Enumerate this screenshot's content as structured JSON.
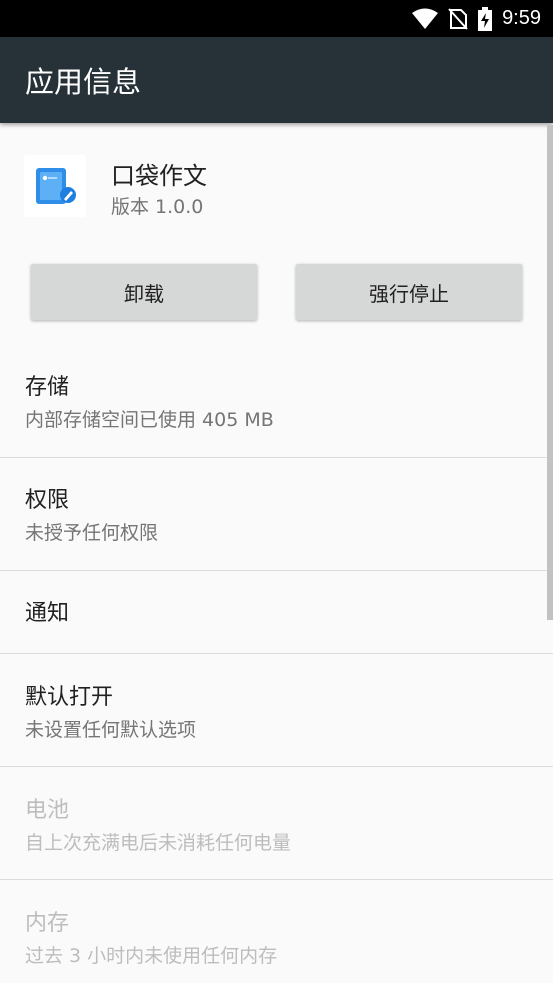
{
  "status_bar": {
    "time": "9:59",
    "icons": [
      "wifi-icon",
      "no-sim-icon",
      "battery-charging-icon"
    ]
  },
  "app_bar": {
    "title": "应用信息"
  },
  "app": {
    "name": "口袋作文",
    "version": "版本 1.0.0",
    "icon": "pocket-composition-app-icon"
  },
  "buttons": {
    "uninstall": "卸载",
    "force_stop": "强行停止"
  },
  "items": [
    {
      "title": "存储",
      "subtitle": "内部存储空间已使用 405 MB",
      "enabled": true
    },
    {
      "title": "权限",
      "subtitle": "未授予任何权限",
      "enabled": true
    },
    {
      "title": "通知",
      "subtitle": "",
      "enabled": true
    },
    {
      "title": "默认打开",
      "subtitle": "未设置任何默认选项",
      "enabled": true
    },
    {
      "title": "电池",
      "subtitle": "自上次充满电后未消耗任何电量",
      "enabled": false
    },
    {
      "title": "内存",
      "subtitle": "过去 3 小时内未使用任何内存",
      "enabled": false
    }
  ],
  "colors": {
    "app_bar_bg": "#263238",
    "status_bar_bg": "#000000",
    "button_bg": "#d6d7d7",
    "disabled_text": "#bdbdbd"
  }
}
